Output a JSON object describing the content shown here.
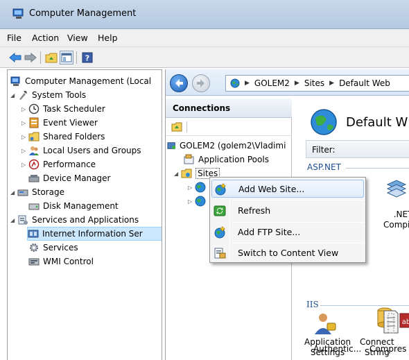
{
  "window": {
    "title": "Computer Management"
  },
  "menu": [
    "File",
    "Action",
    "View",
    "Help"
  ],
  "tree": {
    "root": "Computer Management (Local",
    "system_tools": "System Tools",
    "task_scheduler": "Task Scheduler",
    "event_viewer": "Event Viewer",
    "shared_folders": "Shared Folders",
    "local_users": "Local Users and Groups",
    "performance": "Performance",
    "device_manager": "Device Manager",
    "storage": "Storage",
    "disk_management": "Disk Management",
    "services_apps": "Services and Applications",
    "iis": "Internet Information Ser",
    "services": "Services",
    "wmi": "WMI Control"
  },
  "address": {
    "parts": [
      "GOLEM2",
      "Sites",
      "Default Web"
    ]
  },
  "connections": {
    "header": "Connections",
    "server": "GOLEM2 (golem2\\Vladimi",
    "app_pools": "Application Pools",
    "sites": "Sites"
  },
  "content": {
    "title": "Default W",
    "filter_label": "Filter:",
    "group_aspnet": "ASP.NET",
    "group_iis": "IIS",
    "features": {
      "net_compilation": [
        ".NET",
        "Compilati"
      ],
      "app_settings": [
        "Application",
        "Settings"
      ],
      "conn_strings": [
        "Connect",
        "String"
      ],
      "authentication": "Authentic...",
      "compression": "Compres"
    }
  },
  "context_menu": {
    "items": [
      "Add Web Site...",
      "Refresh",
      "Add FTP Site...",
      "Switch to Content View"
    ]
  },
  "colors": {
    "title_bar": "#c9d8ea",
    "selection": "#cce8ff",
    "menu_highlight": "#e2ecfa",
    "link_blue": "#1e4f8f"
  }
}
